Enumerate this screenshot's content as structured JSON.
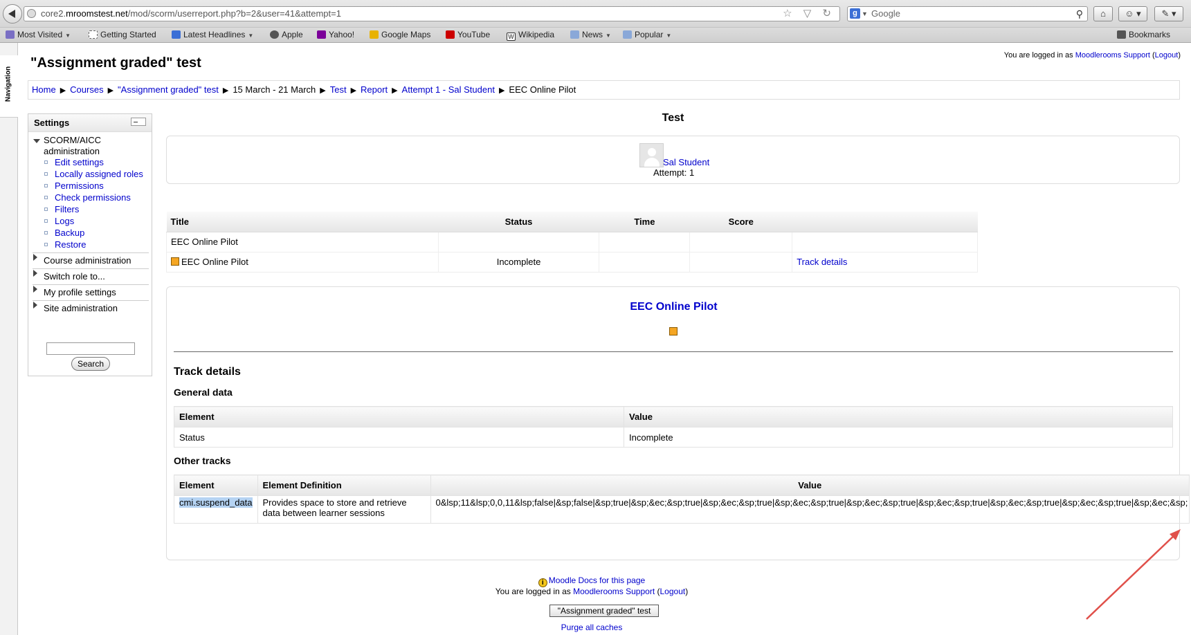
{
  "browser": {
    "url_prefix": "core2.",
    "url_host": "mroomstest.net",
    "url_path": "/mod/scorm/userreport.php?b=2&user=41&attempt=1",
    "search_placeholder": "Google",
    "bookmarks": [
      {
        "label": "Most Visited",
        "color": "#7a6fc4"
      },
      {
        "label": "Getting Started",
        "color": "#cccccc"
      },
      {
        "label": "Latest Headlines",
        "color": "#3b6fd6"
      },
      {
        "label": "Apple",
        "color": "#555555"
      },
      {
        "label": "Yahoo!",
        "color": "#7b0099"
      },
      {
        "label": "Google Maps",
        "color": "#e8b200"
      },
      {
        "label": "YouTube",
        "color": "#cc0000"
      },
      {
        "label": "Wikipedia",
        "color": "#333333"
      },
      {
        "label": "News",
        "color": "#8aa8d8"
      },
      {
        "label": "Popular",
        "color": "#8aa8d8"
      }
    ],
    "bookmarks_menu": "Bookmarks"
  },
  "nav_strip": {
    "label": "Navigation"
  },
  "header": {
    "course_title": "\"Assignment graded\" test",
    "login_prefix": "You are logged in as ",
    "login_user": "Moodlerooms Support",
    "logout": "Logout"
  },
  "breadcrumb": [
    {
      "label": "Home",
      "link": true
    },
    {
      "label": "Courses",
      "link": true
    },
    {
      "label": "\"Assignment graded\" test",
      "link": true
    },
    {
      "label": "15 March - 21 March",
      "link": false
    },
    {
      "label": "Test",
      "link": true
    },
    {
      "label": "Report",
      "link": true
    },
    {
      "label": "Attempt 1 - Sal Student",
      "link": true
    },
    {
      "label": "EEC Online Pilot",
      "link": false
    }
  ],
  "settings": {
    "title": "Settings",
    "section": "SCORM/AICC administration",
    "items": [
      "Edit settings",
      "Locally assigned roles",
      "Permissions",
      "Check permissions",
      "Filters",
      "Logs",
      "Backup",
      "Restore"
    ],
    "collapsed": [
      "Course administration",
      "Switch role to...",
      "My profile settings",
      "Site administration"
    ],
    "search_button": "Search"
  },
  "main": {
    "heading": "Test",
    "user_name": "Sal Student",
    "attempt": "Attempt: 1",
    "report_table": {
      "headers": [
        "Title",
        "Status",
        "Time",
        "Score"
      ],
      "rows": [
        {
          "title": "EEC Online Pilot",
          "status": "",
          "time": "",
          "score": "",
          "action": ""
        },
        {
          "title": "EEC Online Pilot",
          "status": "Incomplete",
          "time": "",
          "score": "",
          "action": "Track details"
        }
      ]
    },
    "sco_title": "EEC Online Pilot",
    "track_details_heading": "Track details",
    "general_heading": "General data",
    "general_table": {
      "headers": [
        "Element",
        "Value"
      ],
      "rows": [
        {
          "element": "Status",
          "value": "Incomplete"
        }
      ]
    },
    "other_heading": "Other tracks",
    "other_table": {
      "headers": [
        "Element",
        "Element Definition",
        "Value"
      ],
      "rows": [
        {
          "element": "cmi.suspend_data",
          "definition": "Provides space to store and retrieve data between learner sessions",
          "value": "0&lsp;11&lsp;0,0,11&lsp;false|&sp;false|&sp;true|&sp;&ec;&sp;true|&sp;&ec;&sp;true|&sp;&ec;&sp;true|&sp;&ec;&sp;true|&sp;&ec;&sp;true|&sp;&ec;&sp;true|&sp;&ec;&sp;true|&sp;&ec;&sp;"
        }
      ]
    }
  },
  "footer": {
    "docs_link": "Moodle Docs for this page",
    "login_prefix": "You are logged in as ",
    "login_user": "Moodlerooms Support",
    "logout": "Logout",
    "course_button": "\"Assignment graded\" test",
    "purge": "Purge all caches"
  },
  "colors": {
    "link": "#0000cc",
    "sco_icon": "#f5a623",
    "annotation_arrow": "#e0504a"
  }
}
